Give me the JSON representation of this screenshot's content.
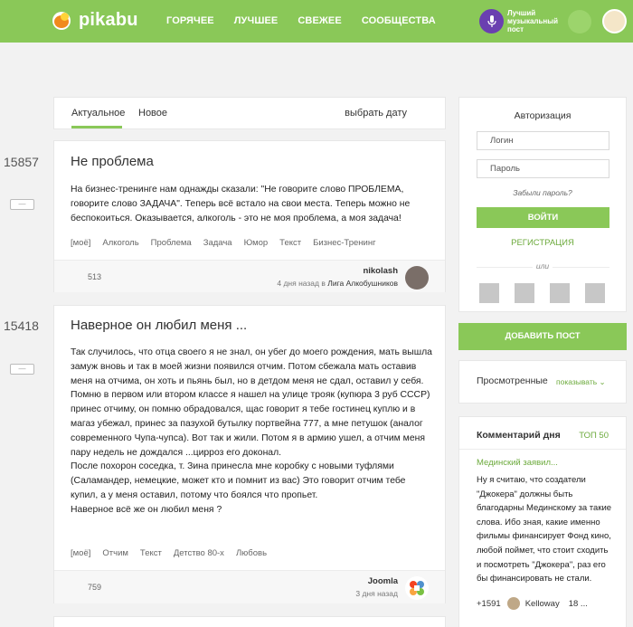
{
  "header": {
    "logo_text": "pikabu",
    "nav": [
      "ГОРЯЧЕЕ",
      "ЛУЧШЕЕ",
      "СВЕЖЕЕ",
      "СООБЩЕСТВА"
    ],
    "music_promo": "Лучший музыкальный пост"
  },
  "feed": {
    "tabs": {
      "active": "Актуальное",
      "new": "Новое",
      "date": "выбрать дату"
    },
    "stories": [
      {
        "rating": "15857",
        "title": "Не проблема",
        "body": "На бизнес-тренинге нам однажды сказали: \"Не говорите слово ПРОБЛЕМА, говорите слово ЗАДАЧА\". Теперь всё встало на свои места. Теперь можно не беспокоиться. Оказывается, алкоголь - это не моя проблема, а моя задача!",
        "tags": [
          "[моё]",
          "Алкоголь",
          "Проблема",
          "Задача",
          "Юмор",
          "Текст",
          "Бизнес-Тренинг"
        ],
        "comments": "513",
        "author": "nikolash",
        "time": "4 дня назад в",
        "community": "Лига Алкобушников"
      },
      {
        "rating": "15418",
        "title": "Наверное он любил меня ...",
        "body": "Так случилось, что отца своего я не знал, он убег до моего рождения, мать вышла замуж вновь и так в моей жизни появился отчим. Потом сбежала мать оставив меня на отчима, он хоть и пьянь был, но в детдом меня не сдал, оставил у себя.\nПомню в первом или втором классе я нашел на улице трояк (купюра 3 руб СССР) принес отчиму, он помню обрадовался, щас говорит я тебе гостинец куплю и в магаз убежал, принес за пазухой бутылку портвейна 777, а мне петушок (аналог современного Чупа-чупса). Вот так и жили. Потом я в армию ушел, а отчим меня пару недель не дождался ...цирроз его доконал.\nПосле похорон соседка, т. Зина принесла мне коробку с новыми туфлями (Саламандер, немецкие, может кто и помнит из вас) Это говорит отчим тебе купил, а у меня оставил, потому что боялся что пропьет.\nНаверное всё же он любил меня ?",
        "tags": [
          "[моё]",
          "Отчим",
          "Текст",
          "Детство 80-х",
          "Любовь"
        ],
        "comments": "759",
        "author": "Joomla",
        "time": "3 дня назад"
      }
    ],
    "minus_label": "—"
  },
  "sidebar": {
    "auth": {
      "title": "Авторизация",
      "login_placeholder": "Логин",
      "password_placeholder": "Пароль",
      "forgot": "Забыли пароль?",
      "login_button": "ВОЙТИ",
      "register": "РЕГИСТРАЦИЯ",
      "or": "или"
    },
    "add_post": "ДОБАВИТЬ ПОСТ",
    "viewed": {
      "label": "Просмотренные",
      "show": "показывать"
    },
    "comment_of_day": {
      "title": "Комментарий дня",
      "top": "ТОП 50",
      "story_title": "Мединский заявил...",
      "text": "Ну я считаю, что создатели \"Джокера\" должны быть благодарны Мединскому за такие слова. Ибо зная, какие именно фильмы финансирует Фонд кино, любой поймет, что стоит сходить и посмотреть \"Джокера\", раз его бы финансировать не стали.",
      "rating": "+1591",
      "author": "Kelloway",
      "time": "18 ..."
    }
  },
  "colors": {
    "brand_green": "#8ac858",
    "link_green": "#6caa3c",
    "background": "#f2f2f2"
  }
}
